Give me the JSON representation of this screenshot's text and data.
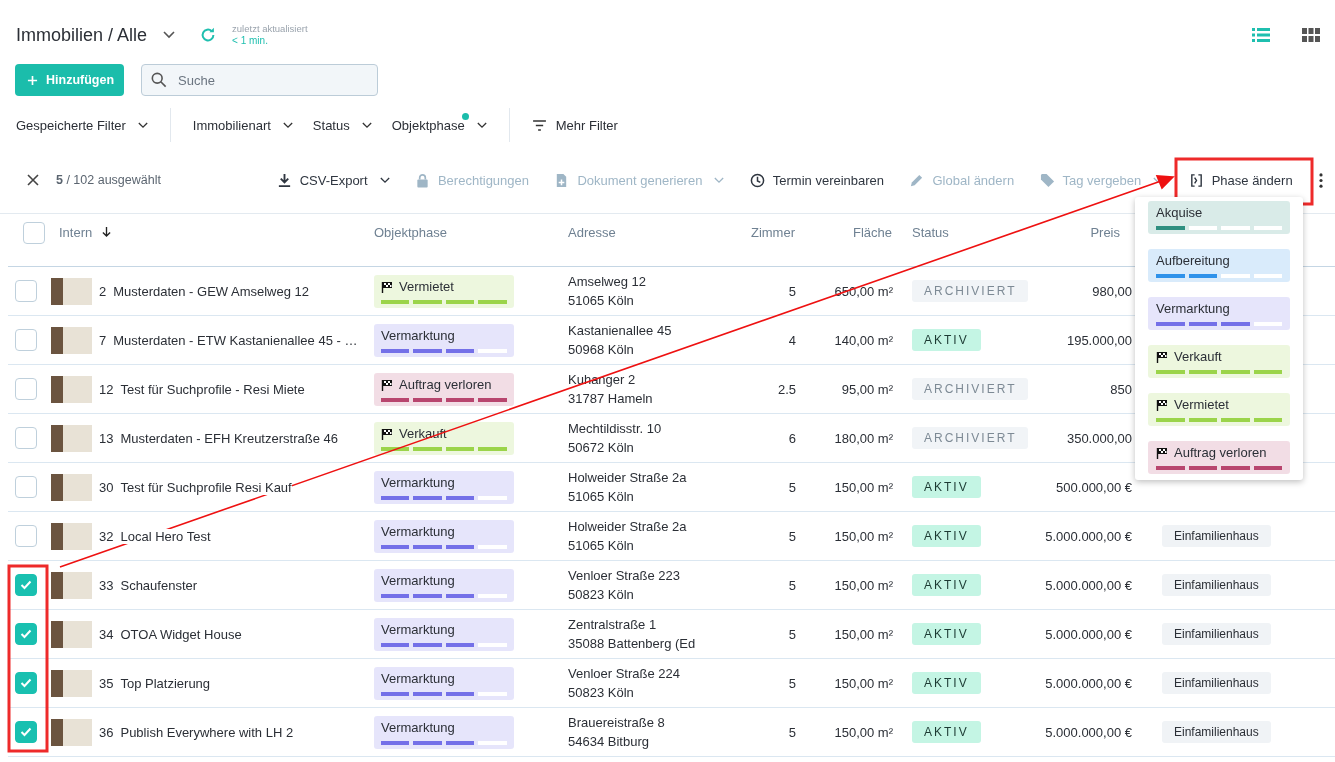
{
  "header": {
    "title": "Immobilien / Alle",
    "updated_label": "zuletzt aktualisiert",
    "updated_value": "< 1 min."
  },
  "view_toggle": [
    {
      "kind": "list",
      "selected": true
    },
    {
      "kind": "grid",
      "selected": false
    }
  ],
  "add_button": {
    "label": "Hinzufügen"
  },
  "search": {
    "placeholder": "Suche"
  },
  "filter_groups": [
    [
      {
        "kind": "dropdown",
        "label": "Gespeicherte Filter",
        "active": false
      }
    ],
    [
      {
        "kind": "dropdown",
        "label": "Immobilienart",
        "active": false
      },
      {
        "kind": "dropdown",
        "label": "Status",
        "active": false
      },
      {
        "kind": "dropdown",
        "label": "Objektphase",
        "active": true
      }
    ],
    [
      {
        "kind": "more",
        "label": "Mehr Filter"
      }
    ]
  ],
  "selection": {
    "text": "**5** / 102 ausgewählt"
  },
  "actions": [
    {
      "kind": "export",
      "label": "CSV-Export",
      "disabled": false,
      "menu": true
    },
    {
      "kind": "permissions",
      "label": "Berechtigungen",
      "disabled": true,
      "menu": false
    },
    {
      "kind": "document",
      "label": "Dokument generieren",
      "disabled": true,
      "menu": true
    },
    {
      "kind": "appointment",
      "label": "Termin vereinbaren",
      "disabled": false,
      "menu": false
    },
    {
      "kind": "edit",
      "label": "Global ändern",
      "disabled": true,
      "menu": false
    },
    {
      "kind": "tag",
      "label": "Tag vergeben",
      "disabled": true,
      "menu": true
    },
    {
      "kind": "phase",
      "label": "Phase ändern",
      "disabled": false,
      "menu": false
    }
  ],
  "table": {
    "all_checked": false,
    "columns": [
      {
        "label": "Intern",
        "sorted": true
      },
      {
        "label": "Objektphase",
        "sorted": false
      },
      {
        "label": "Adresse",
        "sorted": false
      },
      {
        "label": "Zimmer",
        "sorted": false
      },
      {
        "label": "Fläche",
        "sorted": false
      },
      {
        "label": "Status",
        "sorted": false
      },
      {
        "label": "Preis",
        "sorted": false
      }
    ],
    "rows": [
      {
        "checked": false,
        "number": "2",
        "name": "Musterdaten - GEW Amselweg 12",
        "phase": {
          "label": "Vermietet",
          "flag": true,
          "color": "#9bd44a",
          "level": 1
        },
        "address": [
          "Amselweg 12",
          "51065 Köln"
        ],
        "rooms": "5",
        "area": "650,00 m²",
        "status": {
          "kind": "archived",
          "label": "ARCHIVIERT"
        },
        "price": "980,00"
      },
      {
        "checked": false,
        "number": "7",
        "name": "Musterdaten - ETW Kastanienallee 45 - …",
        "phase": {
          "label": "Vermarktung",
          "flag": false,
          "color": "#7470e8",
          "level": 0.75
        },
        "address": [
          "Kastanienallee 45",
          "50968 Köln"
        ],
        "rooms": "4",
        "area": "140,00 m²",
        "status": {
          "kind": "active",
          "label": "AKTIV"
        },
        "price": "195.000,00"
      },
      {
        "checked": false,
        "number": "12",
        "name": "Test für Suchprofile - Resi Miete",
        "phase": {
          "label": "Auftrag verloren",
          "flag": true,
          "color": "#b8456e",
          "level": 1
        },
        "address": [
          "Kuhanger 2",
          "31787 Hameln"
        ],
        "rooms": "2.5",
        "area": "95,00 m²",
        "status": {
          "kind": "archived",
          "label": "ARCHIVIERT"
        },
        "price": "850"
      },
      {
        "checked": false,
        "number": "13",
        "name": "Musterdaten - EFH Kreutzerstraße 46",
        "phase": {
          "label": "Verkauft",
          "flag": true,
          "color": "#9bd44a",
          "level": 1
        },
        "address": [
          "Mechtildisstr. 10",
          "50672 Köln"
        ],
        "rooms": "6",
        "area": "180,00 m²",
        "status": {
          "kind": "archived",
          "label": "ARCHIVIERT"
        },
        "price": "350.000,00"
      },
      {
        "checked": false,
        "number": "30",
        "name": "Test für Suchprofile Resi Kauf",
        "phase": {
          "label": "Vermarktung",
          "flag": false,
          "color": "#7470e8",
          "level": 0.75
        },
        "address": [
          "Holweider Straße 2a",
          "51065 Köln"
        ],
        "rooms": "5",
        "area": "150,00 m²",
        "status": {
          "kind": "active",
          "label": "AKTIV"
        },
        "price": "500.000,00 €"
      },
      {
        "checked": false,
        "number": "32",
        "name": "Local Hero Test",
        "phase": {
          "label": "Vermarktung",
          "flag": false,
          "color": "#7470e8",
          "level": 0.75
        },
        "address": [
          "Holweider Straße 2a",
          "51065 Köln"
        ],
        "rooms": "5",
        "area": "150,00 m²",
        "status": {
          "kind": "active",
          "label": "AKTIV"
        },
        "price": "5.000.000,00 €",
        "type": "Einfamilienhaus"
      },
      {
        "checked": true,
        "number": "33",
        "name": "Schaufenster",
        "phase": {
          "label": "Vermarktung",
          "flag": false,
          "color": "#7470e8",
          "level": 0.75
        },
        "address": [
          "Venloer Straße 223",
          "50823 Köln"
        ],
        "rooms": "5",
        "area": "150,00 m²",
        "status": {
          "kind": "active",
          "label": "AKTIV"
        },
        "price": "5.000.000,00 €",
        "type": "Einfamilienhaus"
      },
      {
        "checked": true,
        "number": "34",
        "name": "OTOA Widget House",
        "phase": {
          "label": "Vermarktung",
          "flag": false,
          "color": "#7470e8",
          "level": 0.75
        },
        "address": [
          "Zentralstraße 1",
          "35088 Battenberg (Ed"
        ],
        "rooms": "5",
        "area": "150,00 m²",
        "status": {
          "kind": "active",
          "label": "AKTIV"
        },
        "price": "5.000.000,00 €",
        "type": "Einfamilienhaus"
      },
      {
        "checked": true,
        "number": "35",
        "name": "Top Platzierung",
        "phase": {
          "label": "Vermarktung",
          "flag": false,
          "color": "#7470e8",
          "level": 0.75
        },
        "address": [
          "Venloer Straße 224",
          "50823 Köln"
        ],
        "rooms": "5",
        "area": "150,00 m²",
        "status": {
          "kind": "active",
          "label": "AKTIV"
        },
        "price": "5.000.000,00 €",
        "type": "Einfamilienhaus"
      },
      {
        "checked": true,
        "number": "36",
        "name": "Publish Everywhere with LH 2",
        "phase": {
          "label": "Vermarktung",
          "flag": false,
          "color": "#7470e8",
          "level": 0.75
        },
        "address": [
          "Brauereistraße 8",
          "54634 Bitburg"
        ],
        "rooms": "5",
        "area": "150,00 m²",
        "status": {
          "kind": "active",
          "label": "AKTIV"
        },
        "price": "5.000.000,00 €",
        "type": "Einfamilienhaus"
      }
    ]
  },
  "phase_menu": [
    {
      "label": "Akquise",
      "flag": false,
      "color": "#2f8f80",
      "level": 0.25
    },
    {
      "label": "Aufbereitung",
      "flag": false,
      "color": "#2f92ea",
      "level": 0.5
    },
    {
      "label": "Vermarktung",
      "flag": false,
      "color": "#7470e8",
      "level": 0.75
    },
    {
      "label": "Verkauft",
      "flag": true,
      "color": "#9bd44a",
      "level": 1
    },
    {
      "label": "Vermietet",
      "flag": true,
      "color": "#9bd44a",
      "level": 1
    },
    {
      "label": "Auftrag verloren",
      "flag": true,
      "color": "#b8456e",
      "level": 1
    }
  ]
}
